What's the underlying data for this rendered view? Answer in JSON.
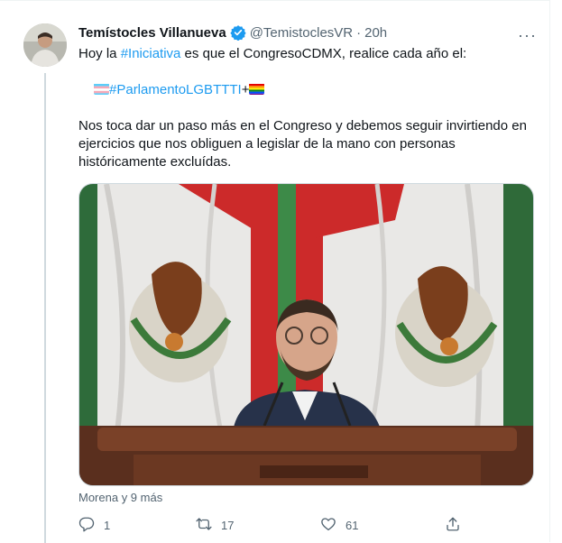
{
  "tweet": {
    "author_name": "Temístocles Villanueva",
    "author_handle": "@TemistoclesVR",
    "separator": "·",
    "time": "20h",
    "more_label": "···",
    "line1_prefix": "Hoy la ",
    "line1_hashtag": "#Iniciativa",
    "line1_suffix": " es que el CongresoCDMX, realice cada año el:",
    "hashtag2": "#ParlamentoLGBTTTI",
    "plus": "+",
    "paragraph": "Nos toca dar un paso más en el Congreso y debemos seguir invirtiendo en ejercicios que nos obliguen a legislar de la mano con personas históricamente excluídas.",
    "reactors": "Morena y 9 más"
  },
  "actions": {
    "reply_count": "1",
    "retweet_count": "17",
    "like_count": "61"
  },
  "colors": {
    "accent": "#1d9bf0",
    "text": "#0f1419",
    "secondary": "#536471",
    "border": "#cfd9de"
  },
  "icons": [
    "verified-badge-icon",
    "more-icon",
    "trans-flag-icon",
    "rainbow-flag-icon",
    "reply-icon",
    "retweet-icon",
    "like-icon",
    "share-icon"
  ]
}
